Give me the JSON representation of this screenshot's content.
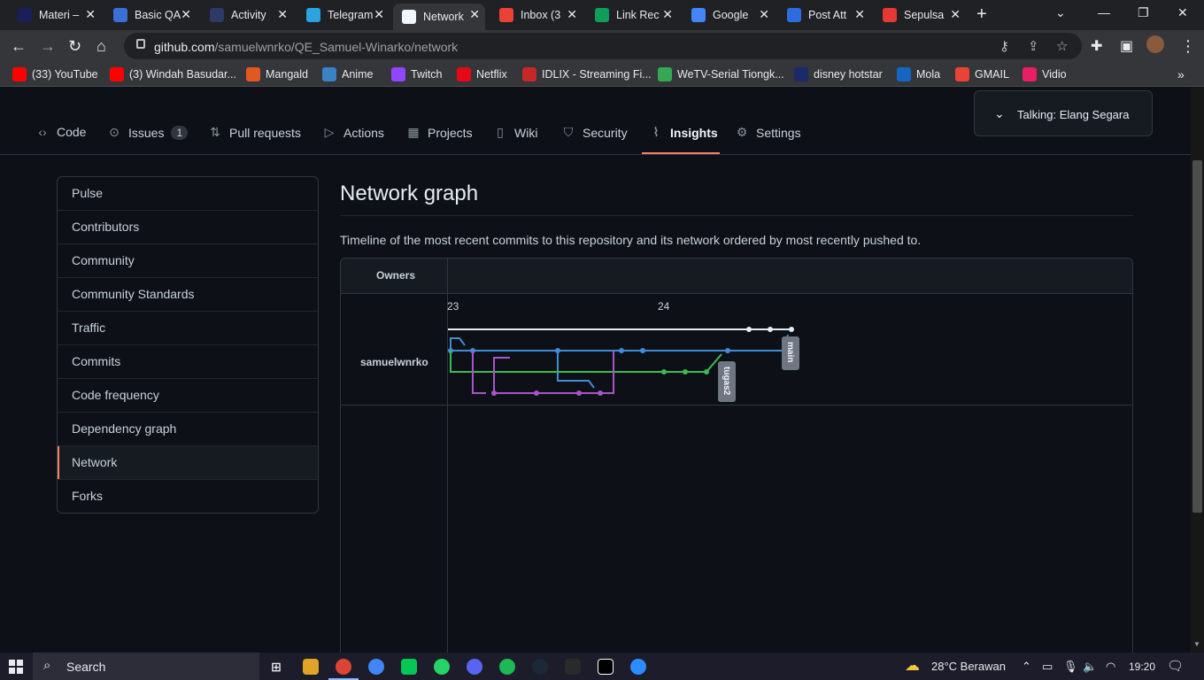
{
  "browser": {
    "tabs": [
      {
        "label": "Materi – ",
        "icon_color": "#1a1f5a"
      },
      {
        "label": "Basic QA",
        "icon_color": "#3b6fd6"
      },
      {
        "label": "Activity",
        "icon_color": "#2b3a67"
      },
      {
        "label": "Telegram",
        "icon_color": "#2aa3e0"
      },
      {
        "label": "Network",
        "icon_color": "#f0f6fc"
      },
      {
        "label": "Inbox (3",
        "icon_color": "#ea4335"
      },
      {
        "label": "Link Rec",
        "icon_color": "#0f9d58"
      },
      {
        "label": "Google",
        "icon_color": "#4285f4"
      },
      {
        "label": "Post Att",
        "icon_color": "#2d6cdf"
      },
      {
        "label": "Sepulsa",
        "icon_color": "#e53935"
      }
    ],
    "url_host": "github.com",
    "url_path": "/samuelwnrko/QE_Samuel-Winarko/network",
    "bookmarks": [
      {
        "label": "(33) YouTube",
        "icon_color": "#ff0000"
      },
      {
        "label": "(3) Windah Basudar...",
        "icon_color": "#ff0000"
      },
      {
        "label": "Mangald",
        "icon_color": "#e25822"
      },
      {
        "label": "Anime",
        "icon_color": "#3b82c4"
      },
      {
        "label": "Twitch",
        "icon_color": "#9146ff"
      },
      {
        "label": "Netflix",
        "icon_color": "#e50914"
      },
      {
        "label": "IDLIX - Streaming Fi...",
        "icon_color": "#c62828"
      },
      {
        "label": "WeTV-Serial Tiongk...",
        "icon_color": "#34a853"
      },
      {
        "label": "disney hotstar",
        "icon_color": "#1b2a6b"
      },
      {
        "label": "Mola",
        "icon_color": "#1565c0"
      },
      {
        "label": "GMAIL",
        "icon_color": "#ea4335"
      },
      {
        "label": "Vidio",
        "icon_color": "#e91e63"
      }
    ]
  },
  "repo_nav": {
    "items": [
      {
        "label": "Code",
        "icon": "code-icon"
      },
      {
        "label": "Issues",
        "icon": "issue-icon",
        "count": "1"
      },
      {
        "label": "Pull requests",
        "icon": "pull-request-icon"
      },
      {
        "label": "Actions",
        "icon": "play-icon"
      },
      {
        "label": "Projects",
        "icon": "table-icon"
      },
      {
        "label": "Wiki",
        "icon": "book-icon"
      },
      {
        "label": "Security",
        "icon": "shield-icon"
      },
      {
        "label": "Insights",
        "icon": "graph-icon",
        "active": true
      },
      {
        "label": "Settings",
        "icon": "gear-icon"
      }
    ]
  },
  "talking_popup": "Talking: Elang Segara",
  "sidebar": {
    "items": [
      {
        "label": "Pulse"
      },
      {
        "label": "Contributors"
      },
      {
        "label": "Community"
      },
      {
        "label": "Community Standards"
      },
      {
        "label": "Traffic"
      },
      {
        "label": "Commits"
      },
      {
        "label": "Code frequency"
      },
      {
        "label": "Dependency graph"
      },
      {
        "label": "Network",
        "selected": true
      },
      {
        "label": "Forks"
      }
    ]
  },
  "main": {
    "title": "Network graph",
    "description": "Timeline of the most recent commits to this repository and its network ordered by most recently pushed to.",
    "owners_label": "Owners",
    "owner": "samuelwnrko",
    "dates": [
      "23",
      "24"
    ],
    "branches": [
      {
        "name": "main",
        "color": "#3f8dd6"
      },
      {
        "name": "tugas2",
        "color": "#3fb950"
      }
    ],
    "line_colors": {
      "white": "#e6edf3",
      "blue": "#3f8dd6",
      "green": "#3fb950",
      "purple": "#a855c7"
    }
  },
  "taskbar": {
    "search": "Search",
    "weather": "28°C  Berawan",
    "time": "19:20"
  }
}
